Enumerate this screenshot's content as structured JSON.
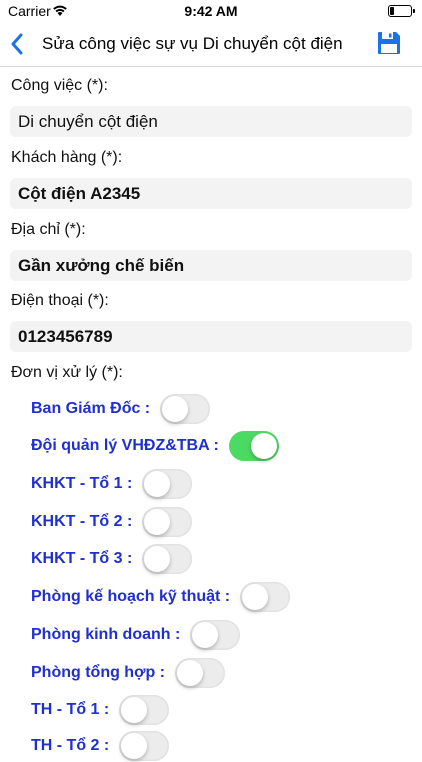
{
  "status": {
    "carrier": "Carrier",
    "time": "9:42 AM"
  },
  "nav": {
    "title": "Sửa công việc sự vụ Di chuyển cột điện"
  },
  "form": {
    "cong_viec_label": "Công việc (*):",
    "cong_viec_value": "Di chuyển cột điện",
    "khach_hang_label": "Khách hàng (*):",
    "khach_hang_value": "Cột điện A2345",
    "dia_chi_label": "Địa chỉ (*):",
    "dia_chi_value": "Gần xưởng chế biến",
    "dien_thoai_label": "Điện thoại (*):",
    "dien_thoai_value": "0123456789",
    "don_vi_label": "Đơn vị xử lý (*):"
  },
  "units": [
    {
      "label": "Ban Giám Đốc :",
      "on": false
    },
    {
      "label": "Đội quản lý VHĐZ&TBA :",
      "on": true
    },
    {
      "label": "KHKT - Tổ 1 :",
      "on": false
    },
    {
      "label": "KHKT - Tổ 2 :",
      "on": false
    },
    {
      "label": "KHKT - Tổ 3 :",
      "on": false
    },
    {
      "label": "Phòng kế hoạch kỹ thuật :",
      "on": false
    },
    {
      "label": "Phòng kinh doanh :",
      "on": false
    },
    {
      "label": "Phòng tổng hợp :",
      "on": false
    },
    {
      "label": "TH - Tổ 1 :",
      "on": false
    },
    {
      "label": "TH - Tổ 2 :",
      "on": false
    }
  ],
  "colors": {
    "accent": "#1a73e8",
    "unit_label": "#1f2fd0",
    "toggle_on": "#4cd964"
  }
}
